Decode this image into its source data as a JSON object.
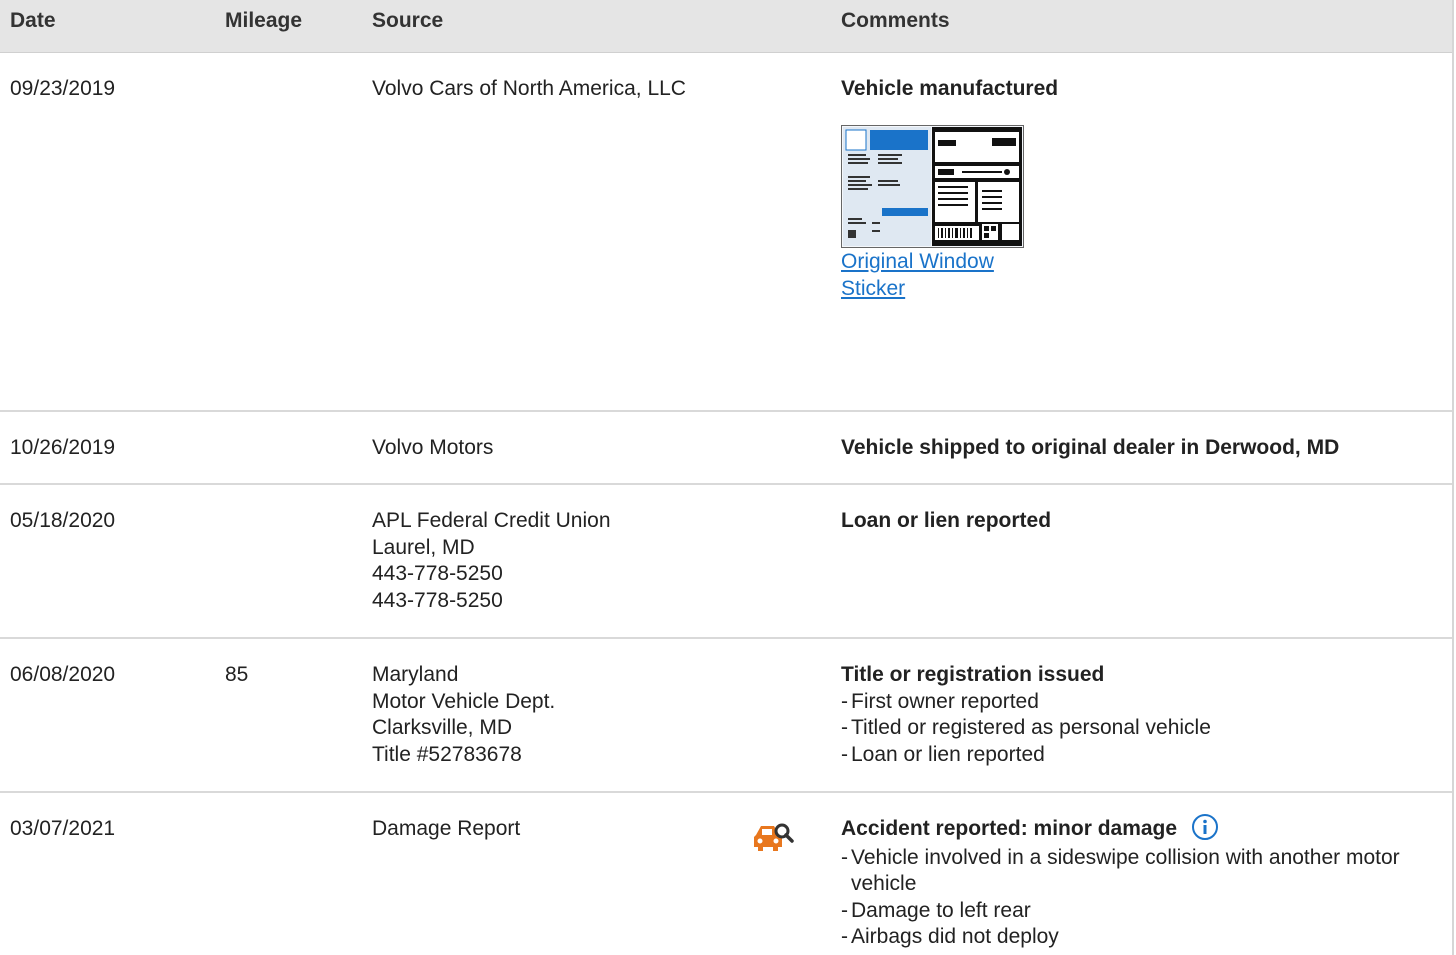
{
  "header": {
    "date": "Date",
    "mileage": "Mileage",
    "source": "Source",
    "comments": "Comments"
  },
  "rows": [
    {
      "date": "09/23/2019",
      "mileage": "",
      "source": [
        "Volvo Cars of North America, LLC"
      ],
      "title": "Vehicle manufactured",
      "sticker_link": "Original Window Sticker"
    },
    {
      "date": "10/26/2019",
      "mileage": "",
      "source": [
        "Volvo Motors"
      ],
      "title": "Vehicle shipped to original dealer in Derwood, MD"
    },
    {
      "date": "05/18/2020",
      "mileage": "",
      "source": [
        "APL Federal Credit Union",
        "Laurel, MD",
        "443-778-5250",
        "443-778-5250"
      ],
      "title": "Loan or lien reported"
    },
    {
      "date": "06/08/2020",
      "mileage": "85",
      "source": [
        "Maryland",
        "Motor Vehicle Dept.",
        "Clarksville, MD",
        "Title #52783678"
      ],
      "title": "Title or registration issued",
      "bullets": [
        "First owner reported",
        "Titled or registered as personal vehicle",
        "Loan or lien reported"
      ]
    },
    {
      "date": "03/07/2021",
      "mileage": "",
      "source": [
        "Damage Report"
      ],
      "icon": "car-damage-search-icon",
      "title": "Accident reported: minor damage",
      "bullets": [
        "Vehicle involved in a sideswipe collision with another motor vehicle",
        "Damage to left rear",
        "Airbags did not deploy"
      ]
    }
  ],
  "colors": {
    "header_bg": "#e5e5e5",
    "link": "#1a73c9",
    "accident_icon": "#e8771e",
    "info_icon": "#1a73c9"
  }
}
